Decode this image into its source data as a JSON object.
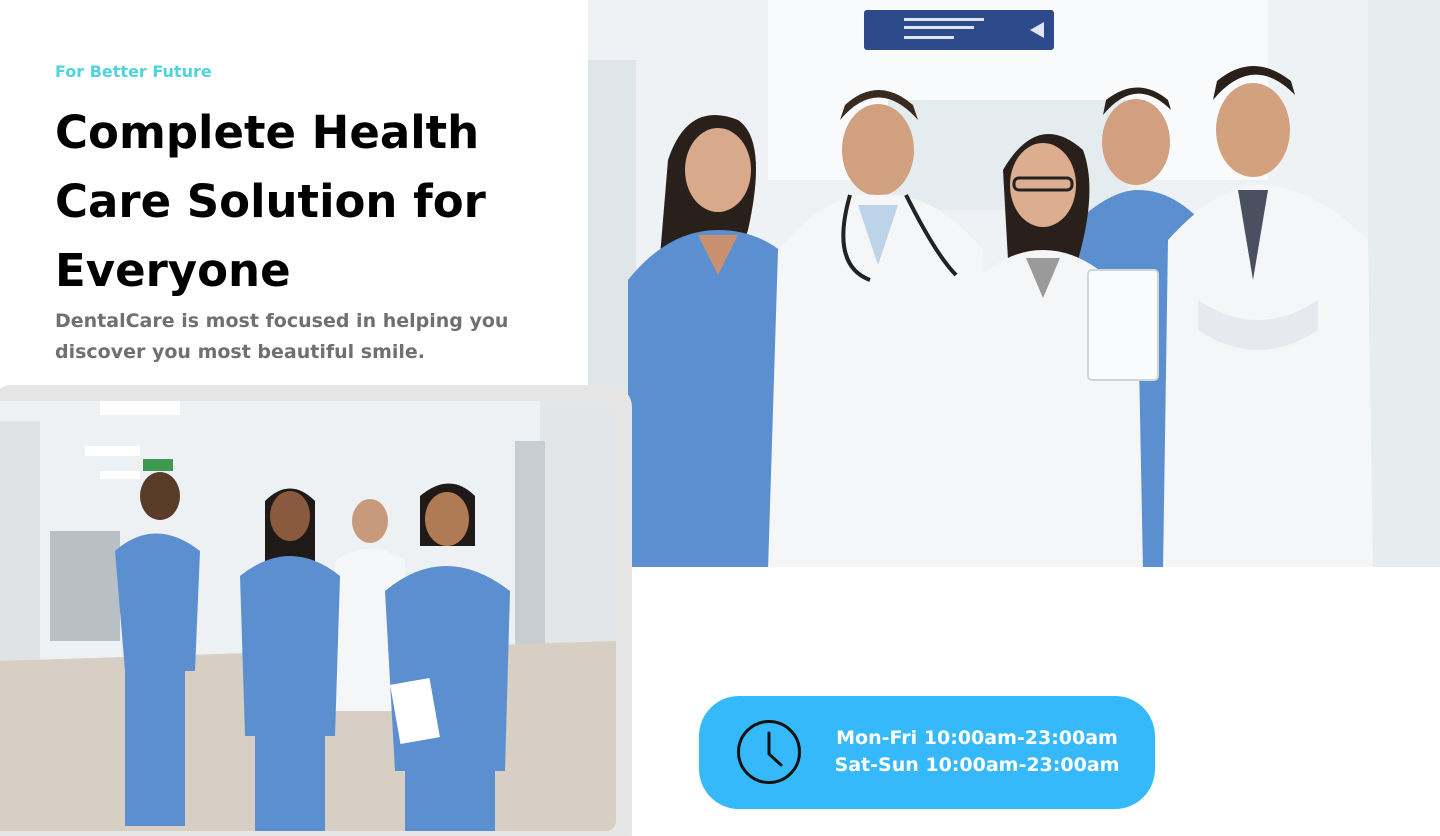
{
  "hero": {
    "eyebrow": "For Better Future",
    "title": "Complete Health Care Solution for Everyone",
    "description": "DentalCare is most focused in helping you discover you most beautiful smile."
  },
  "images": {
    "team_photo": "medical-team-photo",
    "walking_staff_photo": "walking-medical-staff-photo"
  },
  "hours": {
    "icon": "clock-icon",
    "weekdays": "Mon-Fri 10:00am-23:00am",
    "weekend": "Sat-Sun 10:00am-23:00am"
  },
  "colors": {
    "accent": "#4fd3dd",
    "pill": "#36b9fb",
    "heading": "#000000",
    "body_text": "#707070",
    "scrubs": "#5b8fd0",
    "coat": "#f4f6f8"
  }
}
